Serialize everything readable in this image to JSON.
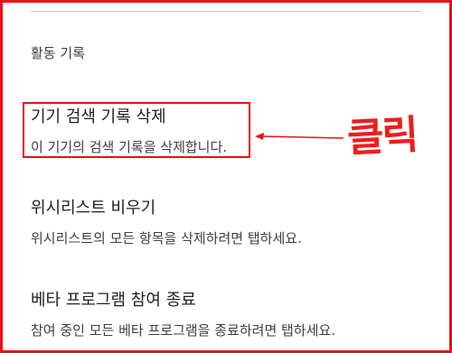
{
  "section_header": "활동 기록",
  "items": [
    {
      "title": "기기 검색 기록 삭제",
      "description": "이 기기의 검색 기록을 삭제합니다."
    },
    {
      "title": "위시리스트 비우기",
      "description": "위시리스트의 모든 항목을 삭제하려면 탭하세요."
    },
    {
      "title": "베타 프로그램 참여 종료",
      "description": "참여 중인 모든 베타 프로그램을 종료하려면 탭하세요."
    }
  ],
  "annotation": {
    "label": "클릭",
    "color": "#ee1d1d"
  },
  "colors": {
    "highlight": "#e8101a",
    "title_text": "#202124",
    "body_text": "#3c4043"
  }
}
